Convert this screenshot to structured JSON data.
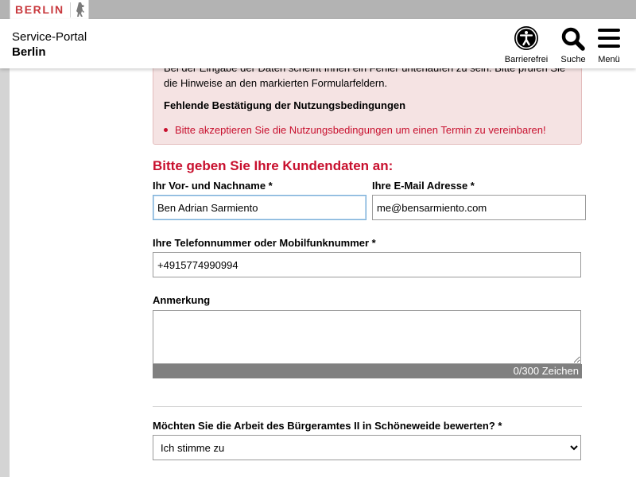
{
  "brand": {
    "logo_text": "BERLIN",
    "accent": "#c8102e"
  },
  "header": {
    "portal_line1": "Service-Portal",
    "portal_line2": "Berlin",
    "accessibility_label": "Barrierefrei",
    "search_label": "Suche",
    "menu_label": "Menü"
  },
  "alert": {
    "text": "Bei der Eingabe der Daten scheint Ihnen ein Fehler unterlaufen zu sein. Bitte prüfen Sie die Hinweise an den markierten Formularfeldern.",
    "heading": "Fehlende Bestätigung der Nutzungsbedingungen",
    "items": [
      "Bitte akzeptieren Sie die Nutzungsbedingungen um einen Termin zu vereinbaren!"
    ]
  },
  "form": {
    "title": "Bitte geben Sie Ihre Kundendaten an:",
    "name_label": "Ihr Vor- und Nachname *",
    "name_value": "Ben Adrian Sarmiento",
    "email_label": "Ihre E-Mail Adresse *",
    "email_value": "me@bensarmiento.com",
    "phone_label": "Ihre Telefonnummer oder Mobilfunknummer *",
    "phone_value": "+4915774990994",
    "remark_label": "Anmerkung",
    "remark_value": "",
    "remark_counter": "0/300 Zeichen",
    "rating_label": "Möchten Sie die Arbeit des Bürgeramtes II in Schöneweide bewerten? *",
    "rating_value": "Ich stimme zu",
    "rating_options": [
      "Ich stimme zu"
    ]
  }
}
